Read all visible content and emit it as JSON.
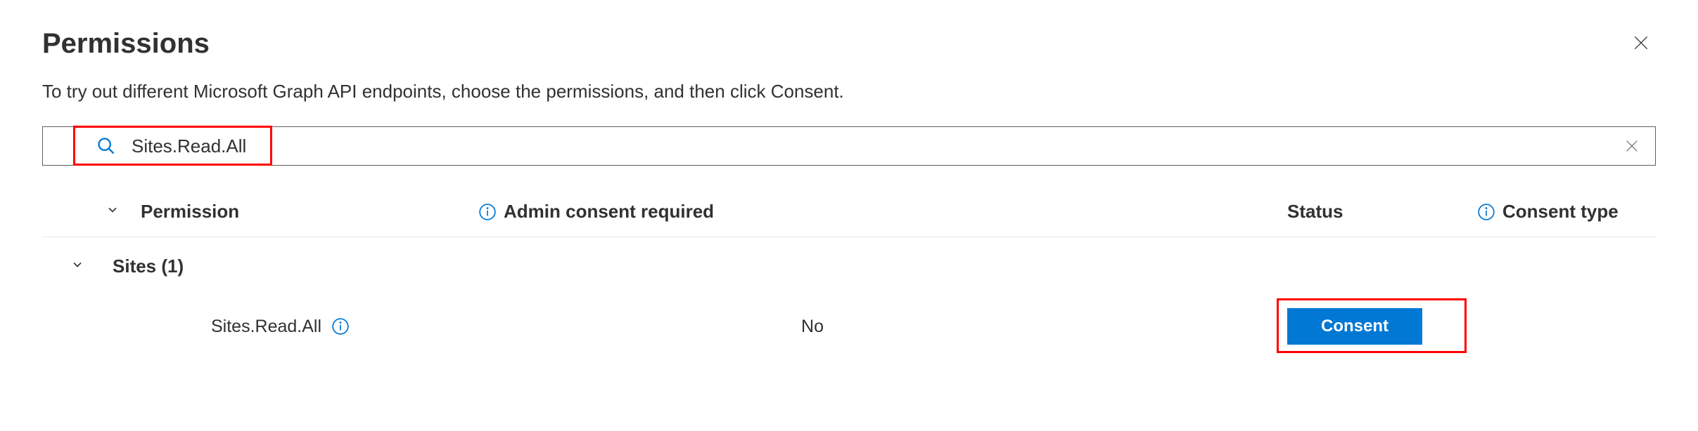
{
  "header": {
    "title": "Permissions",
    "subtitle": "To try out different Microsoft Graph API endpoints, choose the permissions, and then click Consent."
  },
  "search": {
    "value": "Sites.Read.All"
  },
  "table": {
    "columns": {
      "permission": "Permission",
      "admin_consent": "Admin consent required",
      "status": "Status",
      "consent_type": "Consent type"
    },
    "group": {
      "label": "Sites (1)"
    },
    "rows": [
      {
        "permission": "Sites.Read.All",
        "admin_consent": "No",
        "action_label": "Consent"
      }
    ]
  },
  "colors": {
    "primary": "#0078d4",
    "highlight": "#ff0000"
  }
}
